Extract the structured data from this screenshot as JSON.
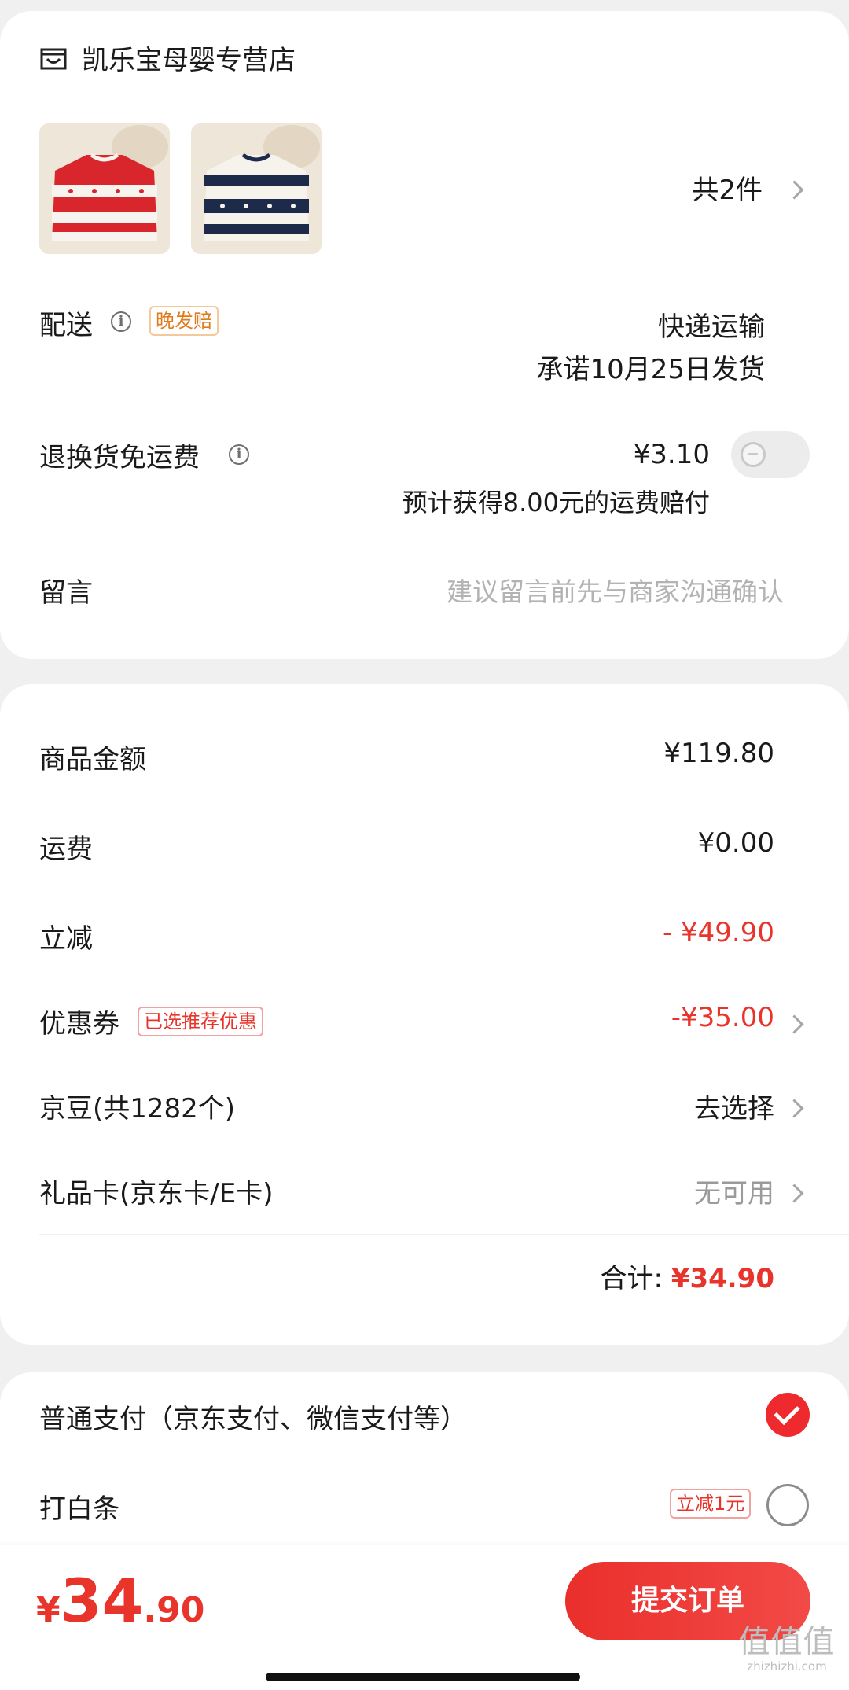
{
  "store": {
    "name": "凯乐宝母婴专营店",
    "item_count": "共2件"
  },
  "delivery": {
    "label": "配送",
    "badge": "晚发赔",
    "method": "快递运输",
    "promise": "承诺10月25日发货"
  },
  "return_insurance": {
    "label": "退换货免运费",
    "price": "¥3.10",
    "note": "预计获得8.00元的运费赔付",
    "enabled": false
  },
  "message": {
    "label": "留言",
    "placeholder": "建议留言前先与商家沟通确认"
  },
  "summary": {
    "goods_label": "商品金额",
    "goods_value": "¥119.80",
    "shipping_label": "运费",
    "shipping_value": "¥0.00",
    "discount_label": "立减",
    "discount_value": "- ¥49.90",
    "coupon_label": "优惠券",
    "coupon_badge": "已选推荐优惠",
    "coupon_value": "-¥35.00",
    "beans_label": "京豆(共1282个)",
    "beans_value": "去选择",
    "giftcard_label": "礼品卡(京东卡/E卡)",
    "giftcard_value": "无可用",
    "total_label": "合计:",
    "total_value": "¥34.90"
  },
  "payment": {
    "normal_label": "普通支付（京东支付、微信支付等）",
    "baitiao_label": "打白条",
    "baitiao_badge": "立减1元",
    "selected": "normal"
  },
  "footer": {
    "currency": "¥",
    "price_int": "34",
    "price_dec": ".90",
    "submit_label": "提交订单"
  },
  "watermark": {
    "text": "值值值",
    "sub": "zhizhizhi.com"
  },
  "colors": {
    "accent": "#e8342b",
    "badge_orange": "#e07a1a",
    "background": "#f0f0f0"
  }
}
